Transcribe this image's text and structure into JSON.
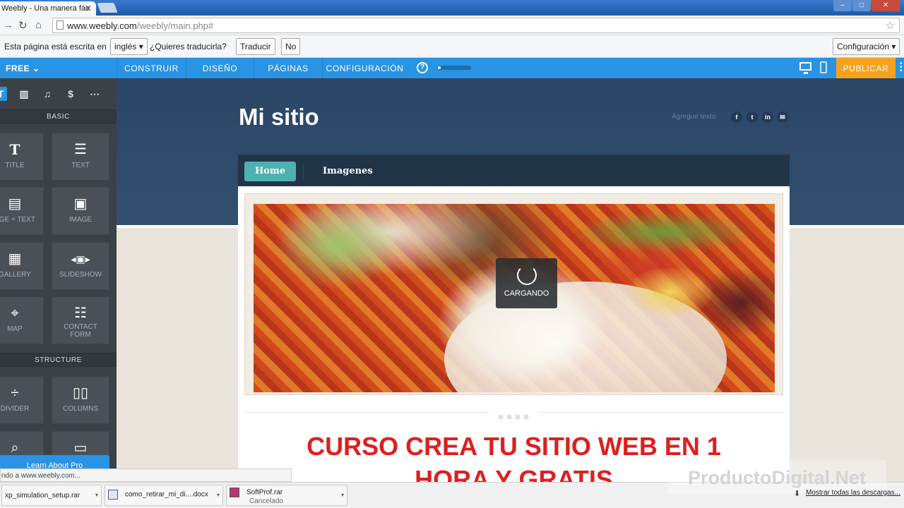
{
  "browser": {
    "tab_title": "Weebly - Una manera fác",
    "url_host": "www.weebly.com",
    "url_path": "/weebly/main.php#",
    "translate": {
      "message": "Esta página está escrita en",
      "language": "inglés",
      "question": "¿Quieres traducirla?",
      "translate_btn": "Traducir",
      "no_btn": "No",
      "settings_btn": "Configuración"
    }
  },
  "weebly_bar": {
    "plan": "FREE",
    "nav": [
      "CONSTRUIR",
      "DISEÑO",
      "PÁGINAS",
      "CONFIGURACIÓN"
    ],
    "help": "?",
    "publish": "PUBLICAR",
    "accent": "#2a93e4",
    "publish_color": "#f6a21d"
  },
  "sidebar": {
    "section_basic": "BASIC",
    "section_structure": "STRUCTURE",
    "tiles": [
      {
        "label": "TITLE",
        "icon": "T"
      },
      {
        "label": "TEXT",
        "icon": "☰"
      },
      {
        "label": "AGE + TEXT",
        "icon": "▤"
      },
      {
        "label": "IMAGE",
        "icon": "▣"
      },
      {
        "label": "GALLERY",
        "icon": "▦"
      },
      {
        "label": "SLIDESHOW",
        "icon": "◂▣▸"
      },
      {
        "label": "MAP",
        "icon": "⌖"
      },
      {
        "label": "CONTACT FORM",
        "icon": "☷"
      },
      {
        "label": "DIVIDER",
        "icon": "÷"
      },
      {
        "label": "COLUMNS",
        "icon": "▯▯"
      }
    ],
    "learn_more": "Learn About Pro"
  },
  "site": {
    "title": "Mi sitio",
    "add_text": "Agregue texto",
    "social": [
      "f",
      "t",
      "in",
      "✉"
    ],
    "nav": [
      "Home",
      "Imagenes"
    ],
    "loading": "CARGANDO",
    "headline_line1": "CURSO CREA TU SITIO WEB EN 1",
    "headline_line2": "HORA Y GRATIS"
  },
  "status": "ndo a www.weebly.com...",
  "downloads": [
    {
      "name": "xp_simulation_setup.rar",
      "sub": ""
    },
    {
      "name": "como_retirar_mi_di....docx",
      "sub": ""
    },
    {
      "name": "SoftProf.rar",
      "sub": "Cancelado"
    }
  ],
  "show_all": "Mostrar todas las descargas...",
  "watermark": "ProductoDigital.Net"
}
